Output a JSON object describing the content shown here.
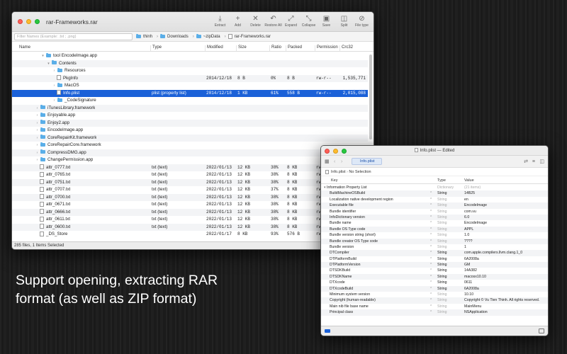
{
  "archive": {
    "title": "rar-Frameworks.rar",
    "toolbar": [
      {
        "label": "Extract",
        "icon": "extract-icon",
        "glyph": "⤓"
      },
      {
        "label": "Add",
        "icon": "add-icon",
        "glyph": "+"
      },
      {
        "label": "Delete",
        "icon": "delete-icon",
        "glyph": "✕"
      },
      {
        "label": "Restore All",
        "icon": "restore-icon",
        "glyph": "↶"
      },
      {
        "label": "Expand",
        "icon": "expand-icon",
        "glyph": "⤢"
      },
      {
        "label": "Collapse",
        "icon": "collapse-icon",
        "glyph": "⤡"
      },
      {
        "label": "Save",
        "icon": "save-icon",
        "glyph": "▣"
      },
      {
        "label": "Split",
        "icon": "split-icon",
        "glyph": "◫"
      },
      {
        "label": "File type",
        "icon": "paperclip-icon",
        "glyph": "⊘"
      }
    ],
    "filter_placeholder": "Filter Names (Example: .txt ; .png)",
    "breadcrumbs": [
      "thinh",
      "Downloads",
      "~zipData",
      "rar-Frameworks.rar"
    ],
    "columns": [
      "Name",
      "Type",
      "Modified",
      "Size",
      "Ratio",
      "Packed",
      "Permission",
      "Crc32"
    ],
    "rows": [
      {
        "indent": 5,
        "disc": "▾",
        "folder": true,
        "name": "tool EncodeImage.app",
        "type": "",
        "mod": "",
        "size": "",
        "ratio": "",
        "packed": "",
        "perm": "",
        "crc": ""
      },
      {
        "indent": 6,
        "disc": "▾",
        "folder": true,
        "name": "Contents",
        "type": "",
        "mod": "",
        "size": "",
        "ratio": "",
        "packed": "",
        "perm": "",
        "crc": ""
      },
      {
        "indent": 7,
        "disc": "›",
        "folder": true,
        "name": "Resources",
        "type": "",
        "mod": "",
        "size": "",
        "ratio": "",
        "packed": "",
        "perm": "",
        "crc": ""
      },
      {
        "indent": 7,
        "disc": "",
        "folder": false,
        "name": "PkgInfo",
        "type": "",
        "mod": "2014/12/18",
        "size": "8 B",
        "ratio": "0%",
        "packed": "8 B",
        "perm": "rw-r--",
        "crc": "1,535,771"
      },
      {
        "indent": 7,
        "disc": "›",
        "folder": true,
        "name": "MacOS",
        "type": "",
        "mod": "",
        "size": "",
        "ratio": "",
        "packed": "",
        "perm": "",
        "crc": ""
      },
      {
        "indent": 7,
        "disc": "",
        "folder": false,
        "name": "Info.plist",
        "type": "plist (property list)",
        "mod": "2014/12/18",
        "size": "1 KB",
        "ratio": "61%",
        "packed": "558 B",
        "perm": "rw-r--",
        "crc": "2,015,088",
        "selected": true
      },
      {
        "indent": 7,
        "disc": "›",
        "folder": true,
        "name": "_CodeSignature",
        "type": "",
        "mod": "",
        "size": "",
        "ratio": "",
        "packed": "",
        "perm": "",
        "crc": ""
      },
      {
        "indent": 4,
        "disc": "›",
        "folder": true,
        "name": "iTunesLibrary.framework",
        "type": "",
        "mod": "",
        "size": "",
        "ratio": "",
        "packed": "",
        "perm": "",
        "crc": ""
      },
      {
        "indent": 4,
        "disc": "›",
        "folder": true,
        "name": "Enjoyable.app",
        "type": "",
        "mod": "",
        "size": "",
        "ratio": "",
        "packed": "",
        "perm": "",
        "crc": ""
      },
      {
        "indent": 4,
        "disc": "›",
        "folder": true,
        "name": "Enjoy2.app",
        "type": "",
        "mod": "",
        "size": "",
        "ratio": "",
        "packed": "",
        "perm": "",
        "crc": ""
      },
      {
        "indent": 4,
        "disc": "›",
        "folder": true,
        "name": "EncodeImage.app",
        "type": "",
        "mod": "",
        "size": "",
        "ratio": "",
        "packed": "",
        "perm": "",
        "crc": ""
      },
      {
        "indent": 4,
        "disc": "›",
        "folder": true,
        "name": "CoreRepairKit.framework",
        "type": "",
        "mod": "",
        "size": "",
        "ratio": "",
        "packed": "",
        "perm": "",
        "crc": ""
      },
      {
        "indent": 4,
        "disc": "›",
        "folder": true,
        "name": "CoreRepairCore.framework",
        "type": "",
        "mod": "",
        "size": "",
        "ratio": "",
        "packed": "",
        "perm": "",
        "crc": ""
      },
      {
        "indent": 4,
        "disc": "›",
        "folder": true,
        "name": "CompressDMG.app",
        "type": "",
        "mod": "",
        "size": "",
        "ratio": "",
        "packed": "",
        "perm": "",
        "crc": ""
      },
      {
        "indent": 4,
        "disc": "›",
        "folder": true,
        "name": "ChangePermission.app",
        "type": "",
        "mod": "",
        "size": "",
        "ratio": "",
        "packed": "",
        "perm": "",
        "crc": ""
      },
      {
        "indent": 4,
        "disc": "",
        "folder": false,
        "name": "attr_0777.txt",
        "type": "txt (text)",
        "mod": "2022/01/13",
        "size": "12 KB",
        "ratio": "38%",
        "packed": "8 KB",
        "perm": "rw",
        "crc": ""
      },
      {
        "indent": 4,
        "disc": "",
        "folder": false,
        "name": "attr_0765.txt",
        "type": "txt (text)",
        "mod": "2022/01/13",
        "size": "12 KB",
        "ratio": "38%",
        "packed": "8 KB",
        "perm": "rw",
        "crc": ""
      },
      {
        "indent": 4,
        "disc": "",
        "folder": false,
        "name": "attr_0751.txt",
        "type": "txt (text)",
        "mod": "2022/01/13",
        "size": "12 KB",
        "ratio": "38%",
        "packed": "8 KB",
        "perm": "rw",
        "crc": ""
      },
      {
        "indent": 4,
        "disc": "",
        "folder": false,
        "name": "attr_0707.txt",
        "type": "txt (text)",
        "mod": "2022/01/13",
        "size": "12 KB",
        "ratio": "37%",
        "packed": "8 KB",
        "perm": "rw",
        "crc": ""
      },
      {
        "indent": 4,
        "disc": "",
        "folder": false,
        "name": "attr_0700.txt",
        "type": "txt (text)",
        "mod": "2022/01/13",
        "size": "12 KB",
        "ratio": "38%",
        "packed": "8 KB",
        "perm": "rw",
        "crc": ""
      },
      {
        "indent": 4,
        "disc": "",
        "folder": false,
        "name": "attr_0671.txt",
        "type": "txt (text)",
        "mod": "2022/01/13",
        "size": "12 KB",
        "ratio": "38%",
        "packed": "8 KB",
        "perm": "rw",
        "crc": ""
      },
      {
        "indent": 4,
        "disc": "",
        "folder": false,
        "name": "attr_0666.txt",
        "type": "txt (text)",
        "mod": "2022/01/13",
        "size": "12 KB",
        "ratio": "38%",
        "packed": "8 KB",
        "perm": "rw",
        "crc": ""
      },
      {
        "indent": 4,
        "disc": "",
        "folder": false,
        "name": "attr_0611.txt",
        "type": "txt (text)",
        "mod": "2022/01/13",
        "size": "12 KB",
        "ratio": "38%",
        "packed": "8 KB",
        "perm": "rw",
        "crc": ""
      },
      {
        "indent": 4,
        "disc": "",
        "folder": false,
        "name": "attr_0600.txt",
        "type": "txt (text)",
        "mod": "2022/01/13",
        "size": "12 KB",
        "ratio": "38%",
        "packed": "8 KB",
        "perm": "rw",
        "crc": ""
      },
      {
        "indent": 4,
        "disc": "",
        "folder": false,
        "name": "_DS_Store",
        "type": "",
        "mod": "2022/01/17",
        "size": "8 KB",
        "ratio": "93%",
        "packed": "576 B",
        "perm": "rw",
        "crc": ""
      }
    ],
    "status": "285 files, 1 Items Selected"
  },
  "plist": {
    "title": "Info.plist — Edited",
    "tab_label": "Info.plist",
    "crumb_file": "Info.plist",
    "crumb_sel": "No Selection",
    "columns": [
      "Key",
      "Type",
      "Value"
    ],
    "rows": [
      {
        "key": "Information Property List",
        "type": "Dictionary",
        "value": "(21 items)",
        "root": true,
        "gray": true
      },
      {
        "key": "BuildMachineOSBuild",
        "type": "String",
        "value": "14B25"
      },
      {
        "key": "Localization native development region",
        "type": "String",
        "value": "en",
        "gray": true
      },
      {
        "key": "Executable file",
        "type": "String",
        "value": "EncodeImage",
        "gray": true
      },
      {
        "key": "Bundle identifier",
        "type": "String",
        "value": "com.vu",
        "gray": true
      },
      {
        "key": "InfoDictionary version",
        "type": "String",
        "value": "6.0",
        "gray": true
      },
      {
        "key": "Bundle name",
        "type": "String",
        "value": "EncodeImage",
        "gray": true
      },
      {
        "key": "Bundle OS Type code",
        "type": "String",
        "value": "APPL",
        "gray": true
      },
      {
        "key": "Bundle version string (short)",
        "type": "String",
        "value": "1.0",
        "gray": true
      },
      {
        "key": "Bundle creator OS Type code",
        "type": "String",
        "value": "????",
        "gray": true
      },
      {
        "key": "Bundle version",
        "type": "String",
        "value": "1",
        "gray": true
      },
      {
        "key": "DTCompiler",
        "type": "String",
        "value": "com.apple.compilers.llvm.clang.1_0"
      },
      {
        "key": "DTPlatformBuild",
        "type": "String",
        "value": "6A2008a"
      },
      {
        "key": "DTPlatformVersion",
        "type": "String",
        "value": "GM"
      },
      {
        "key": "DTSDKBuild",
        "type": "String",
        "value": "14A382"
      },
      {
        "key": "DTSDKName",
        "type": "String",
        "value": "macosx10.10"
      },
      {
        "key": "DTXcode",
        "type": "String",
        "value": "0611"
      },
      {
        "key": "DTXcodeBuild",
        "type": "String",
        "value": "6A2008a"
      },
      {
        "key": "Minimum system version",
        "type": "String",
        "value": "10.10",
        "gray": true
      },
      {
        "key": "Copyright (human-readable)",
        "type": "String",
        "value": "Copyright © Vu Tien Thinh. All rights reserved.",
        "gray": true
      },
      {
        "key": "Main nib file base name",
        "type": "String",
        "value": "MainMenu",
        "gray": true
      },
      {
        "key": "Principal class",
        "type": "String",
        "value": "NSApplication",
        "gray": true
      }
    ]
  },
  "caption": "Support opening, extracting RAR format (as well as ZIP format)"
}
